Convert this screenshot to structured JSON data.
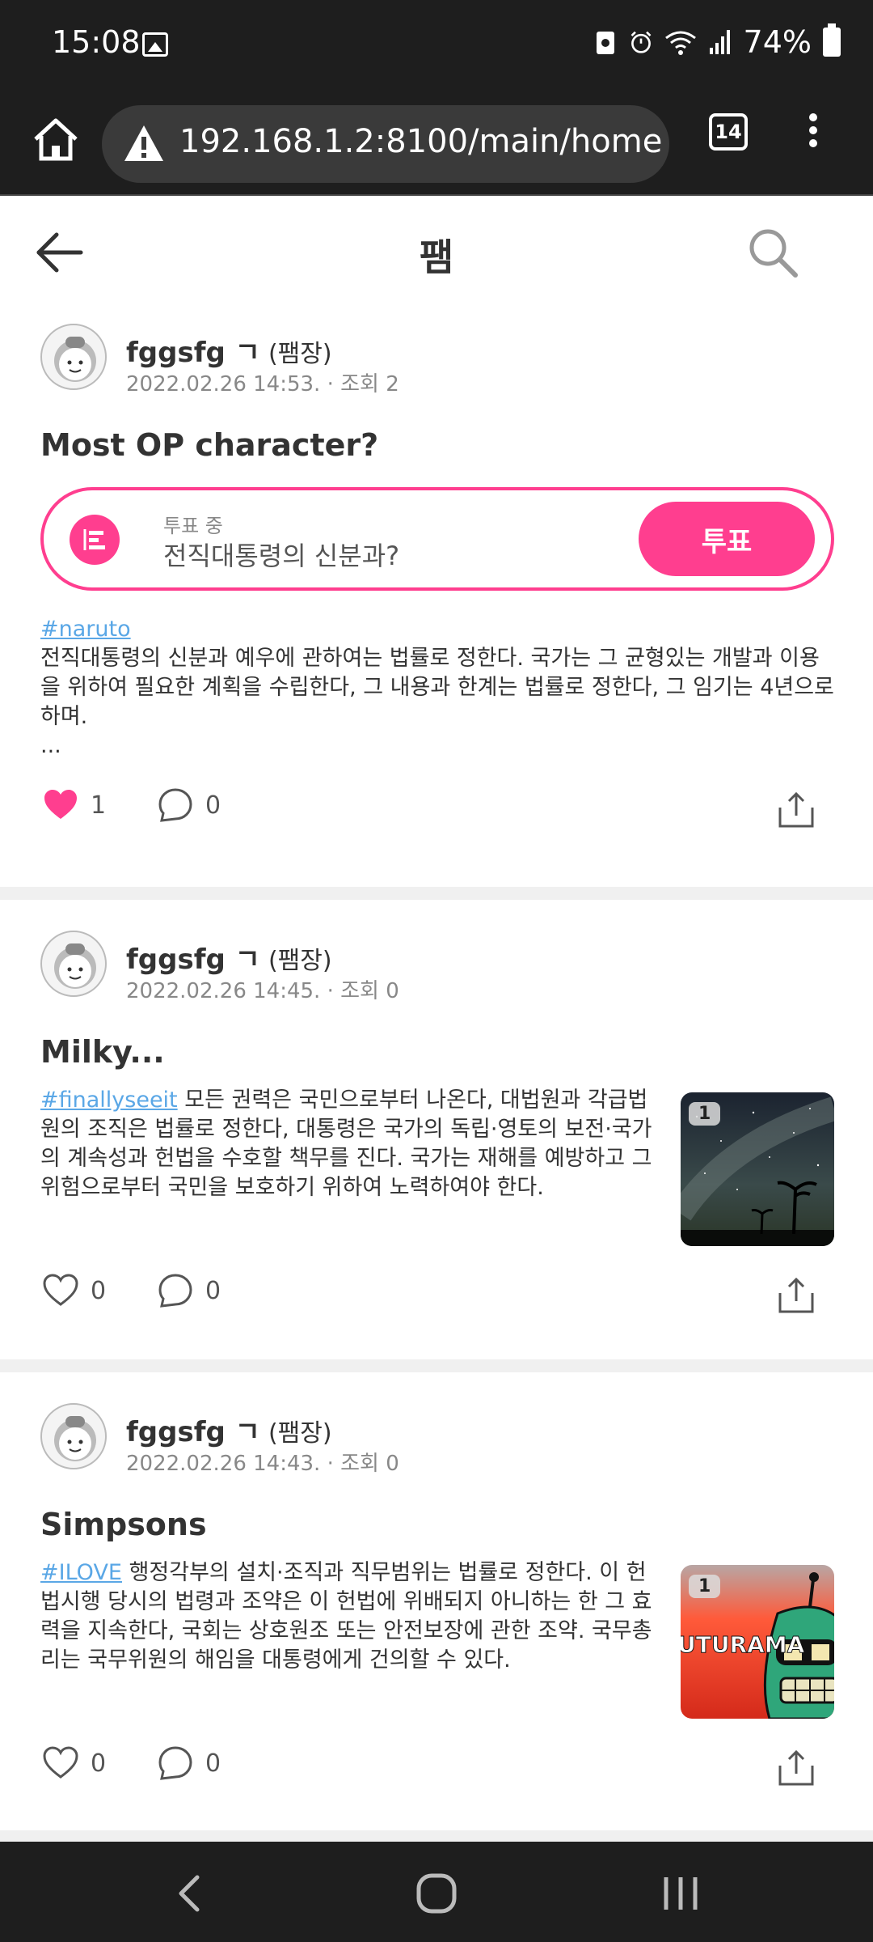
{
  "status_bar": {
    "time": "15:08",
    "battery": "74%"
  },
  "browser": {
    "url": "192.168.1.2:8100/main/home",
    "tab_count": "14"
  },
  "header": {
    "title": "팸"
  },
  "posts": [
    {
      "author": "fggsfg ㄱ",
      "role": "(팸장)",
      "meta": "2022.02.26 14:53. · 조회 2",
      "title": "Most OP character?",
      "vote": {
        "status": "투표 중",
        "question": "전직대통령의 신분과?",
        "button": "투표"
      },
      "tag": "#naruto",
      "body": "전직대통령의 신분과 예우에 관하여는 법률로 정한다. 국가는 그 균형있는 개발과 이용을 위하여 필요한 계획을 수립한다, 그 내용과 한계는 법률로 정한다, 그 임기는 4년으로 하며.",
      "ellipsis": "...",
      "likes": "1",
      "liked": true,
      "comments": "0"
    },
    {
      "author": "fggsfg ㄱ",
      "role": "(팸장)",
      "meta": "2022.02.26 14:45. · 조회 0",
      "title": "Milky...",
      "tag": "#finallyseeit",
      "body": " 모든 권력은 국민으로부터 나온다, 대법원과 각급법원의 조직은 법률로 정한다, 대통령은 국가의 독립·영토의 보전·국가의 계속성과 헌법을 수호할 책무를 진다. 국가는 재해를 예방하고 그 위험으로부터 국민을 보호하기 위하여 노력하여야 한다.",
      "image_count": "1",
      "likes": "0",
      "liked": false,
      "comments": "0"
    },
    {
      "author": "fggsfg ㄱ",
      "role": "(팸장)",
      "meta": "2022.02.26 14:43. · 조회 0",
      "title": "Simpsons",
      "tag": "#ILOVE",
      "body": " 행정각부의 설치·조직과 직무범위는 법률로 정한다. 이 헌법시행 당시의 법령과 조약은 이 헌법에 위배되지 아니하는 한 그 효력을 지속한다, 국회는 상호원조 또는 안전보장에 관한 조약. 국무총리는 국무위원의 해임을 대통령에게 건의할 수 있다.",
      "image_count": "1",
      "image_text": "UTURAMA",
      "likes": "0",
      "liked": false,
      "comments": "0"
    }
  ],
  "colors": {
    "accent": "#ff3e8f",
    "tag": "#5aa7e6",
    "dark_bar": "#1e1e1e"
  }
}
